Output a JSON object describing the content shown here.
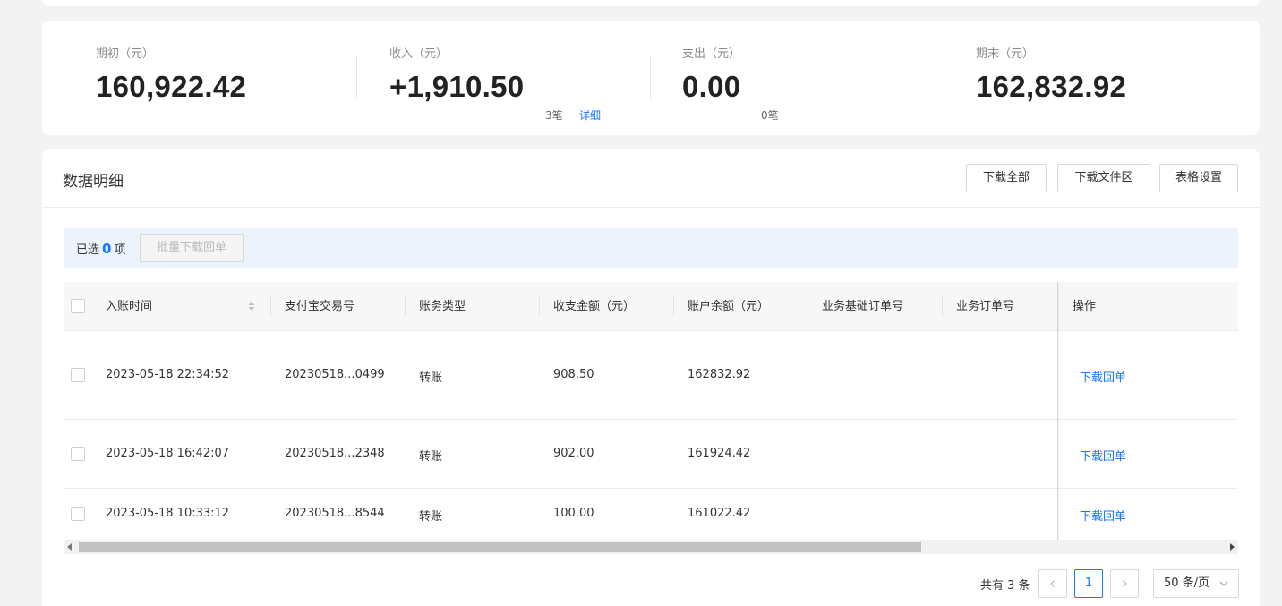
{
  "summary": {
    "opening": {
      "label": "期初（元）",
      "amount": "160,922.42"
    },
    "income": {
      "label": "收入（元）",
      "amount": "+1,910.50",
      "count": "3笔",
      "detail": "详细"
    },
    "expense": {
      "label": "支出（元）",
      "amount": "0.00",
      "count": "0笔"
    },
    "closing": {
      "label": "期末（元）",
      "amount": "162,832.92"
    }
  },
  "panel": {
    "title": "数据明细",
    "buttons": {
      "download_all": "下载全部",
      "download_files": "下载文件区",
      "table_settings": "表格设置"
    }
  },
  "selection": {
    "prefix": "已选",
    "count": "0",
    "suffix": "项",
    "batch_button": "批量下载回单"
  },
  "table": {
    "columns": [
      "入账时间",
      "支付宝交易号",
      "账务类型",
      "收支金额（元）",
      "账户余额（元）",
      "业务基础订单号",
      "业务订单号",
      "操作"
    ],
    "rows": [
      {
        "time": "2023-05-18 22:34:52",
        "trade_no": "20230518...0499",
        "type": "转账",
        "amount": "908.50",
        "balance": "162832.92",
        "base_order": "",
        "order": "",
        "action": "下载回单"
      },
      {
        "time": "2023-05-18 16:42:07",
        "trade_no": "20230518...2348",
        "type": "转账",
        "amount": "902.00",
        "balance": "161924.42",
        "base_order": "",
        "order": "",
        "action": "下载回单"
      },
      {
        "time": "2023-05-18 10:33:12",
        "trade_no": "20230518...8544",
        "type": "转账",
        "amount": "100.00",
        "balance": "161022.42",
        "base_order": "",
        "order": "",
        "action": "下载回单"
      }
    ]
  },
  "pagination": {
    "total": "共有 3 条",
    "current_page": "1",
    "page_size": "50 条/页",
    "prev_icon": "chevron-left-icon",
    "next_icon": "chevron-right-icon"
  },
  "colors": {
    "accent": "#1677ff",
    "selection_bg": "#edf3fd",
    "page_bg": "#f3f3f3"
  }
}
